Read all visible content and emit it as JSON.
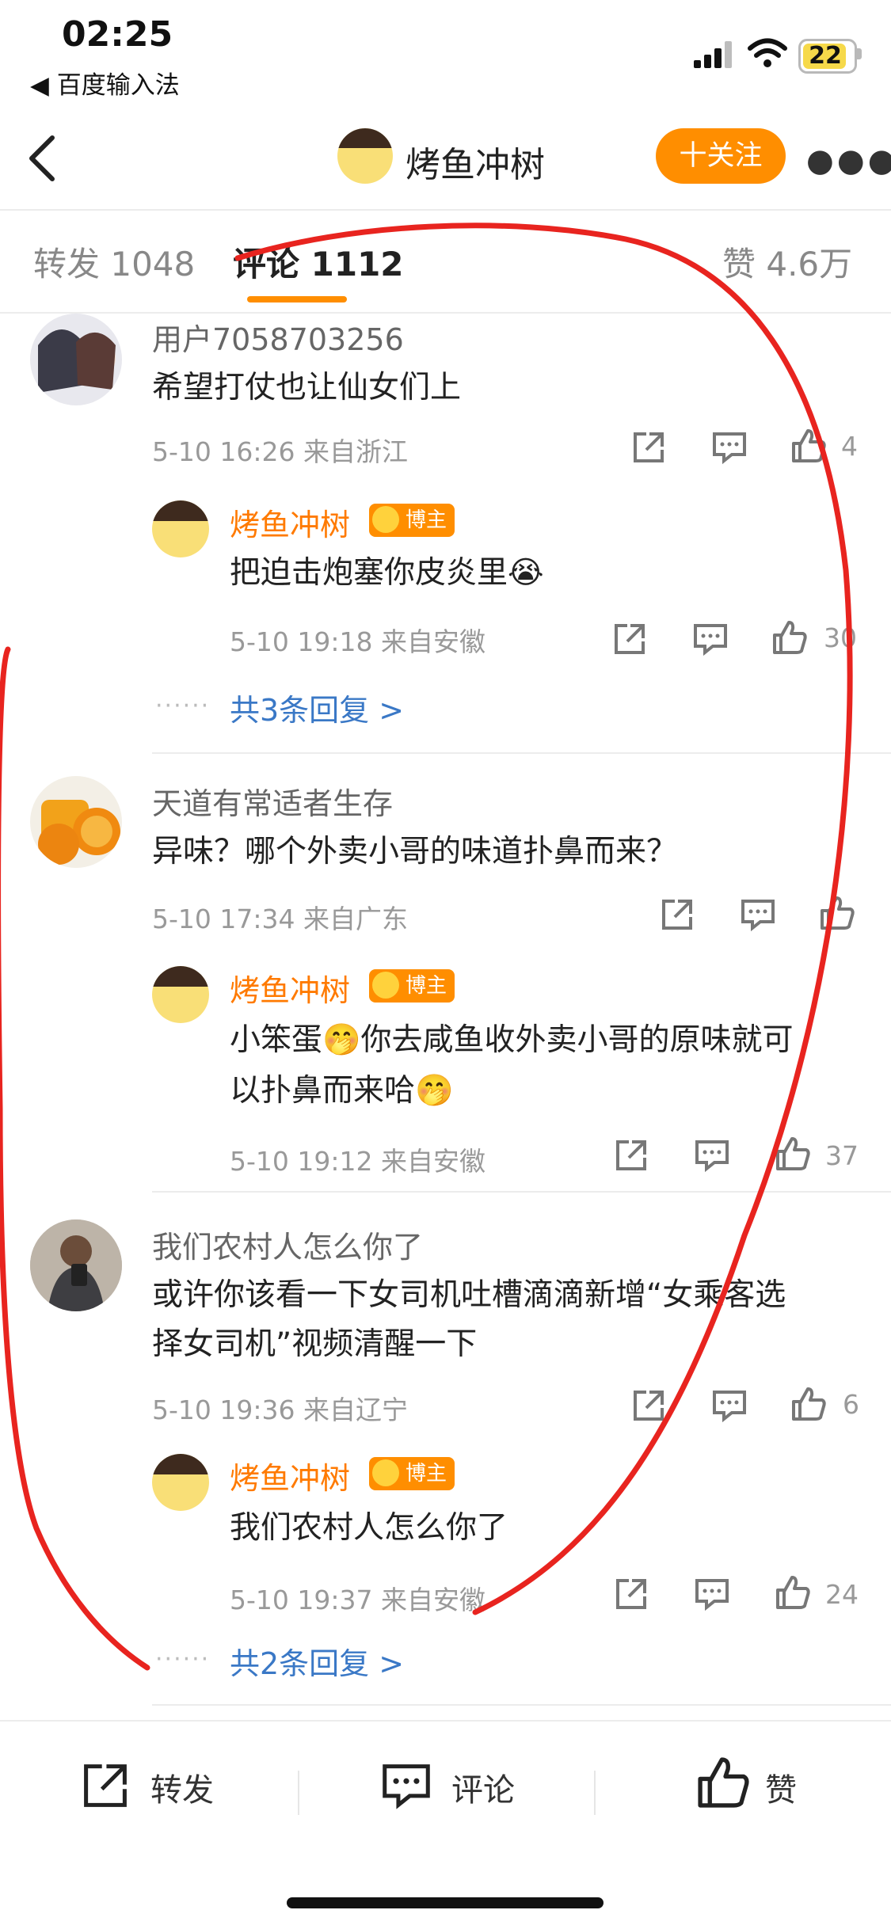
{
  "status_bar": {
    "time": "02:25",
    "back_app": "◀ 百度输入法",
    "battery": "22"
  },
  "nav": {
    "title": "烤鱼冲树",
    "follow_label": "十关注"
  },
  "tabs": [
    {
      "label": "转发 1048"
    },
    {
      "label": "评论 1112"
    },
    {
      "label": "赞 4.6万"
    }
  ],
  "comments": [
    {
      "user": "用户7058703256",
      "text": "希望打仗也让仙女们上",
      "meta": "5-10 16:26 来自浙江",
      "likes": "4",
      "reply": {
        "user": "烤鱼冲树",
        "badge": "博主",
        "text": "把迫击炮塞你皮炎里😭",
        "meta": "5-10 19:18 来自安徽",
        "likes": "30"
      },
      "more": "共3条回复 >"
    },
    {
      "user": "天道有常适者生存",
      "text": "异味？哪个外卖小哥的味道扑鼻而来？",
      "meta": "5-10 17:34 来自广东",
      "likes": "",
      "reply": {
        "user": "烤鱼冲树",
        "badge": "博主",
        "text_line1": "小笨蛋🤭你去咸鱼收外卖小哥的原味就可",
        "text_line2": "以扑鼻而来哈🤭",
        "meta": "5-10 19:12 来自安徽",
        "likes": "37"
      }
    },
    {
      "user": "我们农村人怎么你了",
      "text_line1": "或许你该看一下女司机吐槽滴滴新增“女乘客选",
      "text_line2": "择女司机”视频清醒一下",
      "meta": "5-10 19:36 来自辽宁",
      "likes": "6",
      "reply": {
        "user": "烤鱼冲树",
        "badge": "博主",
        "text": "我们农村人怎么你了",
        "meta": "5-10 19:37 来自安徽",
        "likes": "24"
      },
      "more": "共2条回复 >"
    }
  ],
  "bottom_bar": {
    "repost": "转发",
    "comment": "评论",
    "like": "赞"
  },
  "colors": {
    "accent": "#ff8e00",
    "link": "#3a78c6",
    "annotation": "#e8241f"
  }
}
